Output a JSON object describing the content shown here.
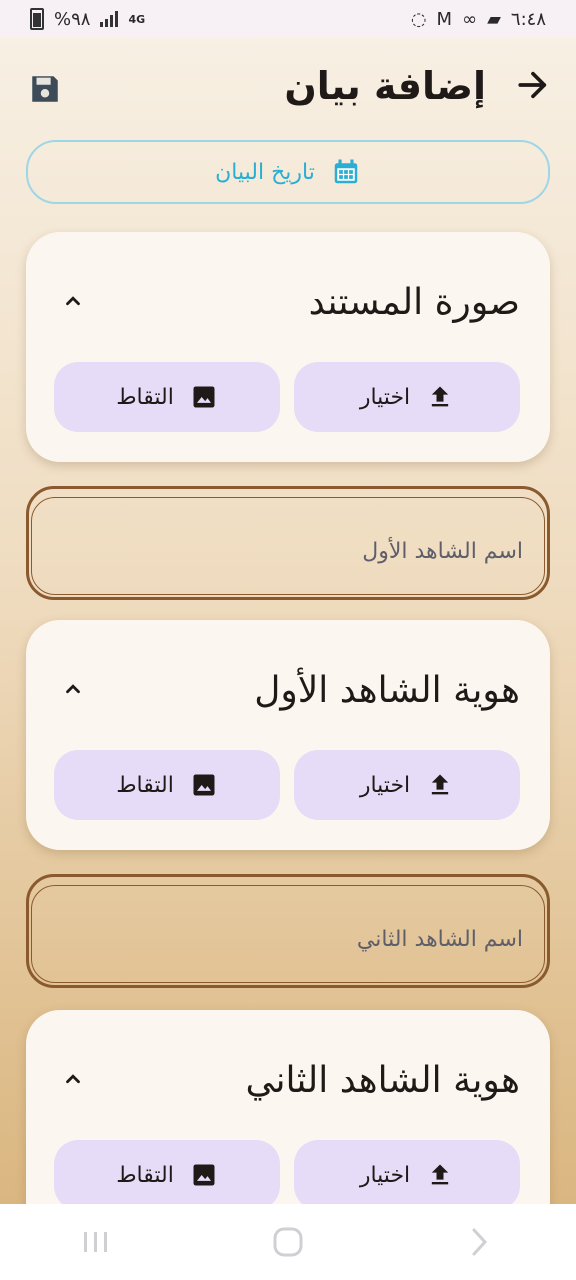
{
  "status_bar": {
    "time": "٦:٤٨",
    "battery": "%٩٨",
    "network": "4G",
    "icons": [
      "battery-icon",
      "signal-icon",
      "screen-record-icon",
      "gmail-icon",
      "link-icon",
      "message-icon"
    ]
  },
  "header": {
    "title": "إضافة بيان",
    "back_icon": "arrow-right-icon",
    "save_icon": "floppy-save-icon"
  },
  "date_button": {
    "label": "تاريخ البيان",
    "icon": "calendar-icon",
    "color": "#2aaed3"
  },
  "sections": [
    {
      "title": "صورة المستند",
      "pick_label": "اختيار",
      "capture_label": "التقاط"
    },
    {
      "title": "هوية الشاهد الأول",
      "pick_label": "اختيار",
      "capture_label": "التقاط"
    },
    {
      "title": "هوية الشاهد الثاني",
      "pick_label": "اختيار",
      "capture_label": "التقاط"
    }
  ],
  "fields": [
    {
      "placeholder": "اسم الشاهد الأول"
    },
    {
      "placeholder": "اسم الشاهد الثاني"
    }
  ],
  "colors": {
    "button_bg": "#e7dcf7",
    "field_border": "#8a5a2e",
    "card_bg": "#fbf7f0"
  }
}
